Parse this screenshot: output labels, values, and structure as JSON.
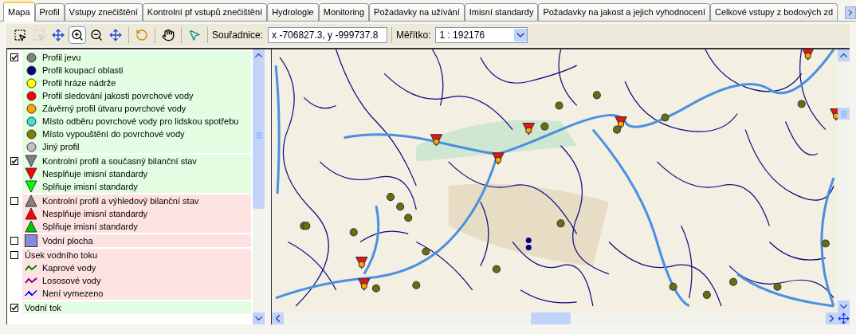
{
  "tabs": [
    {
      "label": "Mapa",
      "selected": true
    },
    {
      "label": "Profil",
      "selected": false
    },
    {
      "label": "Vstupy znečištění",
      "selected": false
    },
    {
      "label": "Kontrolní pf vstupů znečištění",
      "selected": false
    },
    {
      "label": "Hydrologie",
      "selected": false
    },
    {
      "label": "Monitoring",
      "selected": false
    },
    {
      "label": "Požadavky na užívání",
      "selected": false
    },
    {
      "label": "Imisní standardy",
      "selected": false
    },
    {
      "label": "Požadavky na jakost a jejich vyhodnocení",
      "selected": false
    },
    {
      "label": "Celkové vstupy z bodových zd",
      "selected": false
    }
  ],
  "toolbar": {
    "tools": [
      {
        "kind": "select",
        "selected": false,
        "disabled": false
      },
      {
        "kind": "select",
        "selected": false,
        "disabled": true
      },
      {
        "kind": "pan",
        "selected": false,
        "disabled": false
      },
      {
        "kind": "zoom_in",
        "selected": true,
        "disabled": false
      },
      {
        "kind": "zoom_out",
        "selected": false,
        "disabled": false
      },
      {
        "kind": "extent",
        "selected": false,
        "disabled": false
      },
      {
        "kind": "back",
        "selected": false,
        "disabled": false
      },
      {
        "kind": "hand",
        "selected": false,
        "disabled": false
      },
      {
        "kind": "identify",
        "selected": false,
        "disabled": false
      }
    ],
    "coords_label": "Souřadnice:",
    "coords_value": "x -706827.3, y -999737.8",
    "scale_label": "Měřítko:",
    "scale_value": "1 : 192176"
  },
  "legend": [
    {
      "checked": true,
      "items": [
        {
          "kind": "circle",
          "color": "#808080",
          "label": "Profil jevu"
        },
        {
          "kind": "circle",
          "color": "#000080",
          "label": "Profil koupací oblasti"
        },
        {
          "kind": "circle",
          "color": "#ffff00",
          "label": "Profil hráze nádrže"
        },
        {
          "kind": "circle",
          "color": "#ff0000",
          "label": "Profil sledování jakosti povrchové vody"
        },
        {
          "kind": "circle",
          "color": "#ffa500",
          "label": "Závěrný profil útvaru povrchové vody"
        },
        {
          "kind": "circle",
          "color": "#40e0d0",
          "label": "Místo odběru povrchové vody pro lidskou spotřebu"
        },
        {
          "kind": "circle",
          "color": "#808000",
          "label": "Místo vypouštění do povrchové vody"
        },
        {
          "kind": "circle",
          "color": "#c0c0c0",
          "label": "Jiný profil"
        }
      ]
    },
    {
      "checked": true,
      "items": [
        {
          "kind": "triangle_down",
          "color": "#808080",
          "label": "Kontrolní profil a současný bilanční stav"
        },
        {
          "kind": "triangle_down",
          "color": "#ff0000",
          "label": "Nesplňuje imisní standardy"
        },
        {
          "kind": "triangle_down",
          "color": "#00ff00",
          "label": "Splňuje imisní standardy"
        }
      ]
    },
    {
      "checked": false,
      "items": [
        {
          "kind": "triangle_up",
          "color": "#808080",
          "label": "Kontrolní profil a výhledový bilanční stav"
        },
        {
          "kind": "triangle_up",
          "color": "#ff0000",
          "label": "Nesplňuje imisní standardy"
        },
        {
          "kind": "triangle_up",
          "color": "#00cc00",
          "label": "Splňuje imisní standardy"
        }
      ]
    },
    {
      "checked": false,
      "items": [
        {
          "kind": "square",
          "color": "#8888dd",
          "label": "Vodní plocha"
        }
      ]
    },
    {
      "checked": false,
      "items": [
        {
          "kind": "heading",
          "label": "Úsek vodního toku"
        },
        {
          "kind": "line",
          "color": "#008000",
          "label": "Kaprové vody"
        },
        {
          "kind": "line",
          "color": "#800080",
          "label": "Lososové vody"
        },
        {
          "kind": "thin_line",
          "color": "#0000ff",
          "label": "Není vymezeno"
        }
      ]
    },
    {
      "checked": true,
      "items": [
        {
          "kind": "heading",
          "label": "Vodní tok"
        }
      ]
    }
  ]
}
